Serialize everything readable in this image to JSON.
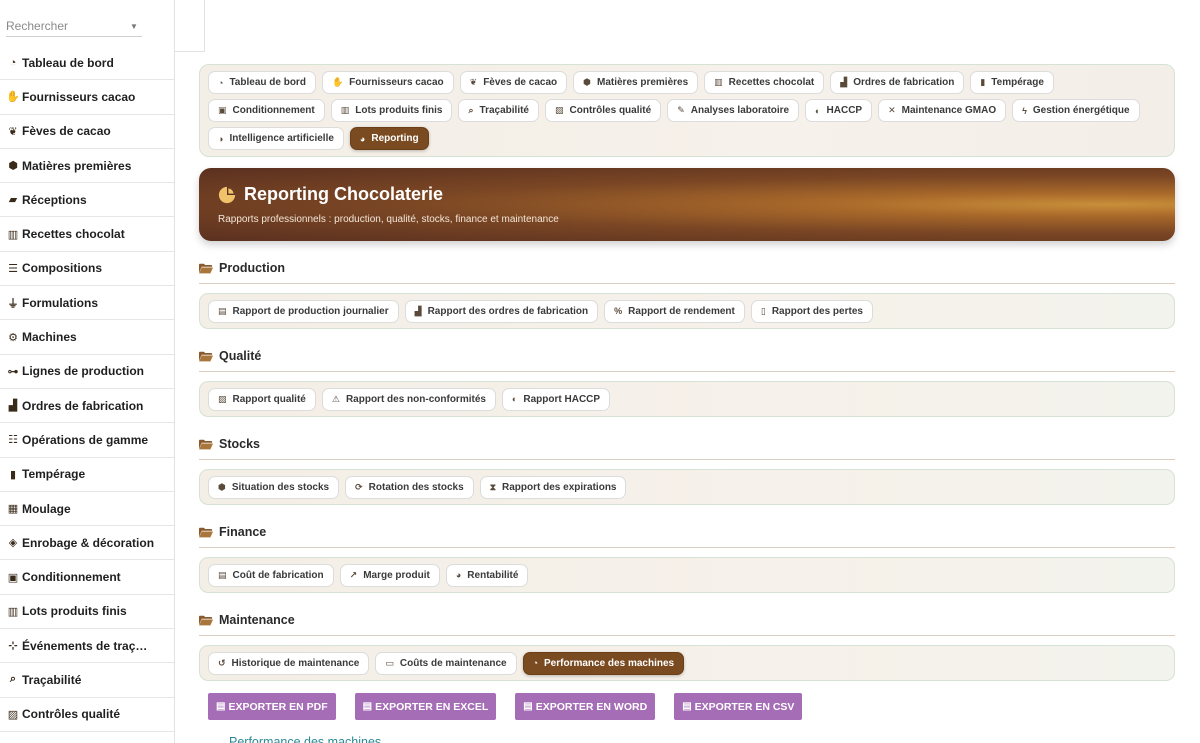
{
  "search": {
    "placeholder": "Rechercher"
  },
  "sidebar": {
    "items": [
      {
        "label": "Tableau de bord",
        "icon": "gauge-icon",
        "glyph": "◔"
      },
      {
        "label": "Fournisseurs cacao",
        "icon": "handshake-icon",
        "glyph": "✋"
      },
      {
        "label": "Fèves de cacao",
        "icon": "seedling-icon",
        "glyph": "❦"
      },
      {
        "label": "Matières premières",
        "icon": "cubes-icon",
        "glyph": "⬢"
      },
      {
        "label": "Réceptions",
        "icon": "truck-icon",
        "glyph": "▰"
      },
      {
        "label": "Recettes chocolat",
        "icon": "book-icon",
        "glyph": "▥"
      },
      {
        "label": "Compositions",
        "icon": "list-icon",
        "glyph": "☰"
      },
      {
        "label": "Formulations",
        "icon": "flask-icon",
        "glyph": "⏚"
      },
      {
        "label": "Machines",
        "icon": "cogs-icon",
        "glyph": "⚙"
      },
      {
        "label": "Lignes de production",
        "icon": "sitemap-icon",
        "glyph": "⊶"
      },
      {
        "label": "Ordres de fabrication",
        "icon": "industry-icon",
        "glyph": "▟"
      },
      {
        "label": "Opérations de gamme",
        "icon": "tasks-icon",
        "glyph": "☷"
      },
      {
        "label": "Tempérage",
        "icon": "thermometer-icon",
        "glyph": "▮"
      },
      {
        "label": "Moulage",
        "icon": "th-large-icon",
        "glyph": "▦"
      },
      {
        "label": "Enrobage & décoration",
        "icon": "fill-drip-icon",
        "glyph": "◈"
      },
      {
        "label": "Conditionnement",
        "icon": "box-icon",
        "glyph": "▣"
      },
      {
        "label": "Lots produits finis",
        "icon": "barcode-icon",
        "glyph": "▥"
      },
      {
        "label": "Événements de traç…",
        "icon": "project-diagram-icon",
        "glyph": "⊹"
      },
      {
        "label": "Traçabilité",
        "icon": "search-icon",
        "glyph": "⌕"
      },
      {
        "label": "Contrôles qualité",
        "icon": "clipboard-check-icon",
        "glyph": "▨"
      }
    ]
  },
  "tabs": [
    {
      "label": "Tableau de bord",
      "icon": "gauge-icon",
      "glyph": "◔"
    },
    {
      "label": "Fournisseurs cacao",
      "icon": "handshake-icon",
      "glyph": "✋"
    },
    {
      "label": "Fèves de cacao",
      "icon": "seedling-icon",
      "glyph": "❦"
    },
    {
      "label": "Matières premières",
      "icon": "cubes-icon",
      "glyph": "⬢"
    },
    {
      "label": "Recettes chocolat",
      "icon": "book-icon",
      "glyph": "▥"
    },
    {
      "label": "Ordres de fabrication",
      "icon": "industry-icon",
      "glyph": "▟"
    },
    {
      "label": "Tempérage",
      "icon": "thermometer-icon",
      "glyph": "▮"
    },
    {
      "label": "Conditionnement",
      "icon": "box-icon",
      "glyph": "▣"
    },
    {
      "label": "Lots produits finis",
      "icon": "barcode-icon",
      "glyph": "▥"
    },
    {
      "label": "Traçabilité",
      "icon": "search-icon",
      "glyph": "⌕"
    },
    {
      "label": "Contrôles qualité",
      "icon": "clipboard-check-icon",
      "glyph": "▨"
    },
    {
      "label": "Analyses laboratoire",
      "icon": "microscope-icon",
      "glyph": "✎"
    },
    {
      "label": "HACCP",
      "icon": "shield-icon",
      "glyph": "◐"
    },
    {
      "label": "Maintenance GMAO",
      "icon": "tools-icon",
      "glyph": "✕"
    },
    {
      "label": "Gestion énergétique",
      "icon": "bolt-icon",
      "glyph": "ϟ"
    },
    {
      "label": "Intelligence artificielle",
      "icon": "brain-icon",
      "glyph": "◑"
    },
    {
      "label": "Reporting",
      "icon": "chart-pie-icon",
      "glyph": "◕",
      "active": true
    }
  ],
  "banner": {
    "title": "Reporting Chocolaterie",
    "subtitle": "Rapports professionnels : production, qualité, stocks, finance et maintenance"
  },
  "sections": [
    {
      "title": "Production",
      "reports": [
        {
          "label": "Rapport de production journalier",
          "icon": "calendar-icon",
          "glyph": "▤"
        },
        {
          "label": "Rapport des ordres de fabrication",
          "icon": "industry-icon",
          "glyph": "▟"
        },
        {
          "label": "Rapport de rendement",
          "icon": "percent-icon",
          "glyph": "%"
        },
        {
          "label": "Rapport des pertes",
          "icon": "trash-icon",
          "glyph": "▯"
        }
      ]
    },
    {
      "title": "Qualité",
      "reports": [
        {
          "label": "Rapport qualité",
          "icon": "clipboard-check-icon",
          "glyph": "▨"
        },
        {
          "label": "Rapport des non-conformités",
          "icon": "warning-icon",
          "glyph": "⚠"
        },
        {
          "label": "Rapport HACCP",
          "icon": "shield-icon",
          "glyph": "◐"
        }
      ]
    },
    {
      "title": "Stocks",
      "reports": [
        {
          "label": "Situation des stocks",
          "icon": "cubes-icon",
          "glyph": "⬢"
        },
        {
          "label": "Rotation des stocks",
          "icon": "sync-icon",
          "glyph": "⟳"
        },
        {
          "label": "Rapport des expirations",
          "icon": "hourglass-icon",
          "glyph": "⧗"
        }
      ]
    },
    {
      "title": "Finance",
      "reports": [
        {
          "label": "Coût de fabrication",
          "icon": "coins-icon",
          "glyph": "▤"
        },
        {
          "label": "Marge produit",
          "icon": "chart-line-icon",
          "glyph": "↗"
        },
        {
          "label": "Rentabilité",
          "icon": "chart-pie-icon",
          "glyph": "◕"
        }
      ]
    },
    {
      "title": "Maintenance",
      "reports": [
        {
          "label": "Historique de maintenance",
          "icon": "history-icon",
          "glyph": "↺"
        },
        {
          "label": "Coûts de maintenance",
          "icon": "money-bill-icon",
          "glyph": "▭"
        },
        {
          "label": "Performance des machines",
          "icon": "gauge-icon",
          "glyph": "◔",
          "active": true
        }
      ]
    }
  ],
  "exports": [
    {
      "label": "EXPORTER EN PDF",
      "icon": "file-pdf-icon"
    },
    {
      "label": "EXPORTER EN EXCEL",
      "icon": "file-excel-icon"
    },
    {
      "label": "EXPORTER EN WORD",
      "icon": "file-word-icon"
    },
    {
      "label": "EXPORTER EN CSV",
      "icon": "file-csv-icon"
    }
  ],
  "report_title": "Performance des machines",
  "colors": {
    "accent": "#7a4a20",
    "export": "#a46db5",
    "link": "#2a8a96",
    "folder": "#8a5a2a"
  }
}
